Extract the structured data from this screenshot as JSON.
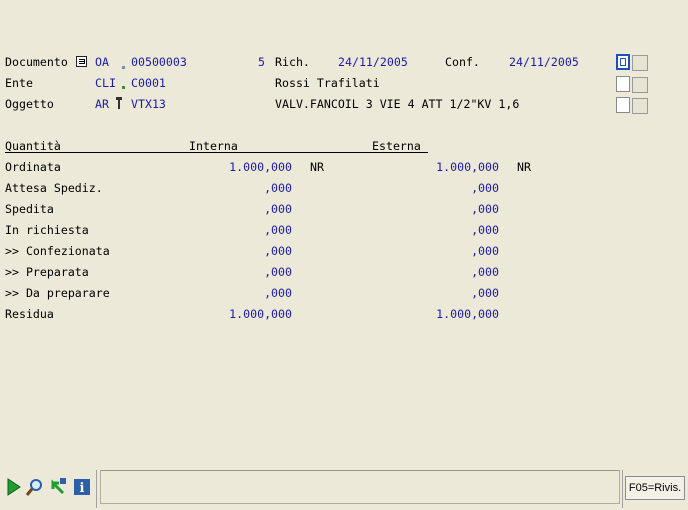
{
  "header": {
    "documento": {
      "label": "Documento",
      "type": "OA",
      "number": "00500003",
      "rev": "5",
      "rich_label": "Rich.",
      "rich_date": "24/11/2005",
      "conf_label": "Conf.",
      "conf_date": "24/11/2005"
    },
    "ente": {
      "label": "Ente",
      "type": "CLI",
      "code": "C0001",
      "name": "Rossi Trafilati"
    },
    "oggetto": {
      "label": "Oggetto",
      "type": "AR",
      "code": "VTX13",
      "description": "VALV.FANCOIL 3 VIE 4 ATT 1/2\"KV 1,6"
    }
  },
  "table": {
    "headers": {
      "col1": "Quantità",
      "col2": "Interna",
      "col3": "Esterna"
    },
    "rows": [
      {
        "label": "Ordinata",
        "interna": "1.000,000",
        "unit_int": "NR",
        "esterna": "1.000,000",
        "unit_ext": "NR"
      },
      {
        "label": "Attesa Spediz.",
        "interna": ",000",
        "unit_int": "",
        "esterna": ",000",
        "unit_ext": ""
      },
      {
        "label": "Spedita",
        "interna": ",000",
        "unit_int": "",
        "esterna": ",000",
        "unit_ext": ""
      },
      {
        "label": "In richiesta",
        "interna": ",000",
        "unit_int": "",
        "esterna": ",000",
        "unit_ext": ""
      },
      {
        "label": ">> Confezionata",
        "interna": ",000",
        "unit_int": "",
        "esterna": ",000",
        "unit_ext": ""
      },
      {
        "label": ">> Preparata",
        "interna": ",000",
        "unit_int": "",
        "esterna": ",000",
        "unit_ext": ""
      },
      {
        "label": ">> Da preparare",
        "interna": ",000",
        "unit_int": "",
        "esterna": ",000",
        "unit_ext": ""
      },
      {
        "label": "Residua",
        "interna": "1.000,000",
        "unit_int": "",
        "esterna": "1.000,000",
        "unit_ext": ""
      }
    ]
  },
  "toolbar": {
    "f05_label": "F05=Rivis.",
    "icons": [
      "play-icon",
      "search-icon",
      "back-arrow-icon",
      "info-icon"
    ]
  },
  "colors": {
    "background": "#ECE9D8",
    "value_blue": "#1a1aa6",
    "accent_blue": "#1f4fbf"
  }
}
